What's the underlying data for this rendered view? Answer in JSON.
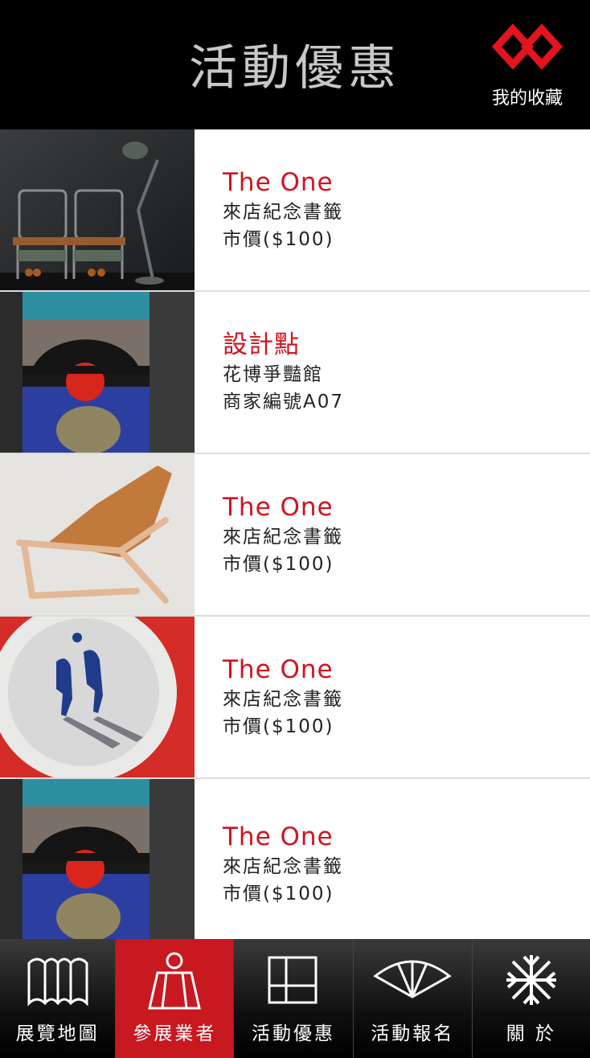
{
  "header": {
    "title": "活動優惠",
    "favorites_label": "我的收藏",
    "accent_color": "#e3141f"
  },
  "items": [
    {
      "title": "The One",
      "line1": "來店紀念書籤",
      "line2": "市價($100)"
    },
    {
      "title": "設計點",
      "line1": "花博爭豔館",
      "line2": "商家編號A07"
    },
    {
      "title": "The One",
      "line1": "來店紀念書籤",
      "line2": "市價($100)"
    },
    {
      "title": "The One",
      "line1": "來店紀念書籤",
      "line2": "市價($100)"
    },
    {
      "title": "The One",
      "line1": "來店紀念書籤",
      "line2": "市價($100)"
    }
  ],
  "nav": {
    "tabs": [
      {
        "label": "展覽地圖",
        "icon": "map-icon"
      },
      {
        "label": "參展業者",
        "icon": "exhibitor-icon",
        "active": true
      },
      {
        "label": "活動優惠",
        "icon": "grid-icon"
      },
      {
        "label": "活動報名",
        "icon": "fan-icon"
      },
      {
        "label": "關 於",
        "icon": "snowflake-icon"
      }
    ],
    "active_color": "#c81820"
  }
}
